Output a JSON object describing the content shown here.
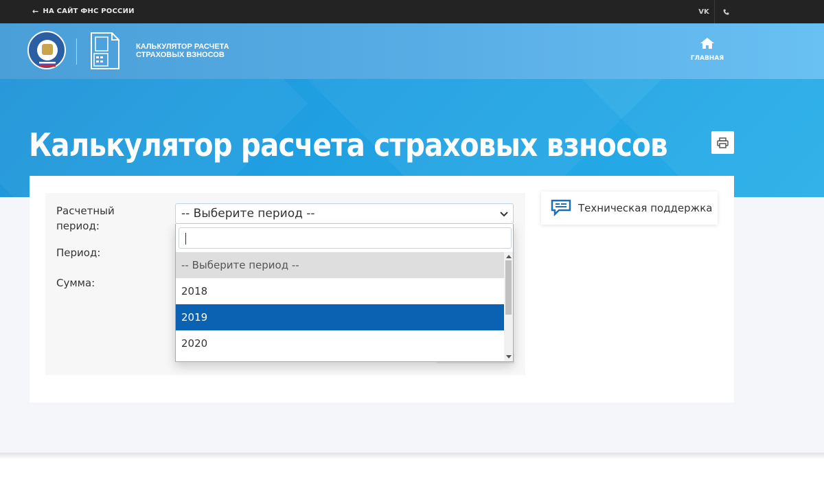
{
  "topbar": {
    "back_link": "НА САЙТ ФНС РОССИИ",
    "vk_label": "VK"
  },
  "header": {
    "brand_line1": "КАЛЬКУЛЯТОР РАСЧЕТА",
    "brand_line2": "СТРАХОВЫХ ВЗНОСОВ",
    "home_label": "ГЛАВНАЯ"
  },
  "hero": {
    "title": "Калькулятор расчета страховых взносов"
  },
  "form": {
    "period_type_label": "Расчетный период:",
    "period_label": "Период:",
    "sum_label": "Сумма:",
    "select_value": "-- Выберите период --",
    "search_value": ""
  },
  "dropdown": {
    "options": [
      "-- Выберите период --",
      "2018",
      "2019",
      "2020"
    ],
    "highlighted": "2019"
  },
  "support": {
    "label": "Техническая поддержка"
  },
  "colors": {
    "accent": "#1fa0e2",
    "highlight": "#0b62b2",
    "topbar": "#232323"
  }
}
